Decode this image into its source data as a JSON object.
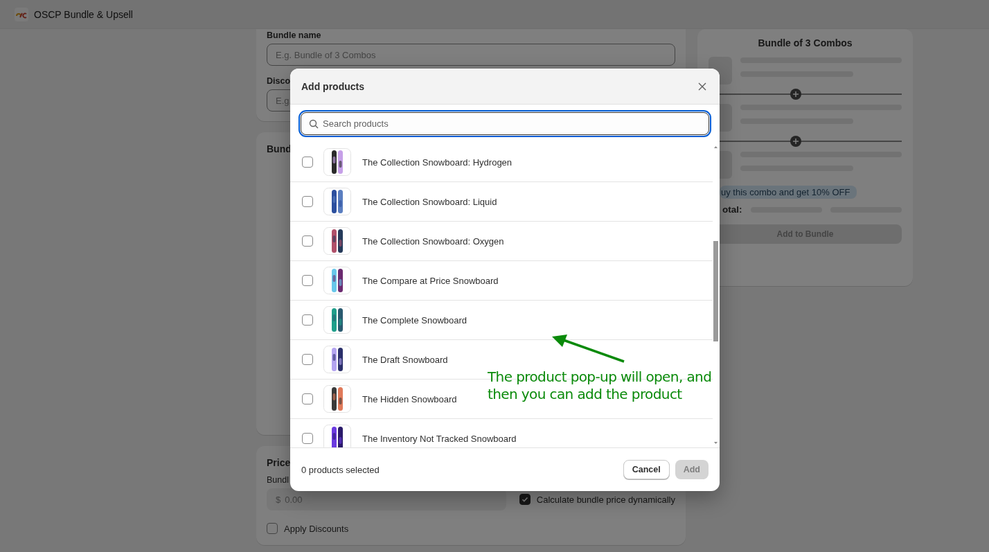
{
  "app_bar": {
    "title": "OSCP Bundle & Upsell"
  },
  "bundle_form": {
    "name_label": "Bundle name",
    "name_placeholder": "E.g. Bundle of 3 Combos",
    "discount_label": "Disco",
    "discount_placeholder": "E.g."
  },
  "bundle_products": {
    "title": "Bund"
  },
  "pricing": {
    "title": "Price",
    "price_label": "Bundl",
    "currency": "$",
    "price_placeholder": "0.00",
    "dynamic_price": {
      "label": "Calculate bundle price dynamically",
      "checked": true
    },
    "apply_discounts": {
      "label": "Apply Discounts",
      "checked": false
    }
  },
  "preview": {
    "title": "Bundle of 3 Combos",
    "offer_badge": "uy this combo and get 10% OFF",
    "total_label": "otal:",
    "add_button": {
      "label": "Add to Bundle",
      "disabled": true
    }
  },
  "modal": {
    "title": "Add products",
    "search": {
      "placeholder": "Search products"
    },
    "products": [
      {
        "name": "The Collection Snowboard: Hydrogen",
        "checked": false
      },
      {
        "name": "The Collection Snowboard: Liquid",
        "checked": false
      },
      {
        "name": "The Collection Snowboard: Oxygen",
        "checked": false
      },
      {
        "name": "The Compare at Price Snowboard",
        "checked": false
      },
      {
        "name": "The Complete Snowboard",
        "checked": false
      },
      {
        "name": "The Draft Snowboard",
        "checked": false
      },
      {
        "name": "The Hidden Snowboard",
        "checked": false
      },
      {
        "name": "The Inventory Not Tracked Snowboard",
        "checked": false
      }
    ],
    "selection_count": "0 products selected",
    "buttons": [
      {
        "label": "Cancel",
        "kind": "secondary",
        "disabled": false
      },
      {
        "label": "Add",
        "kind": "primary",
        "disabled": true
      }
    ]
  },
  "annotation": {
    "text": "The product pop-up will open, and then you can add the product"
  }
}
